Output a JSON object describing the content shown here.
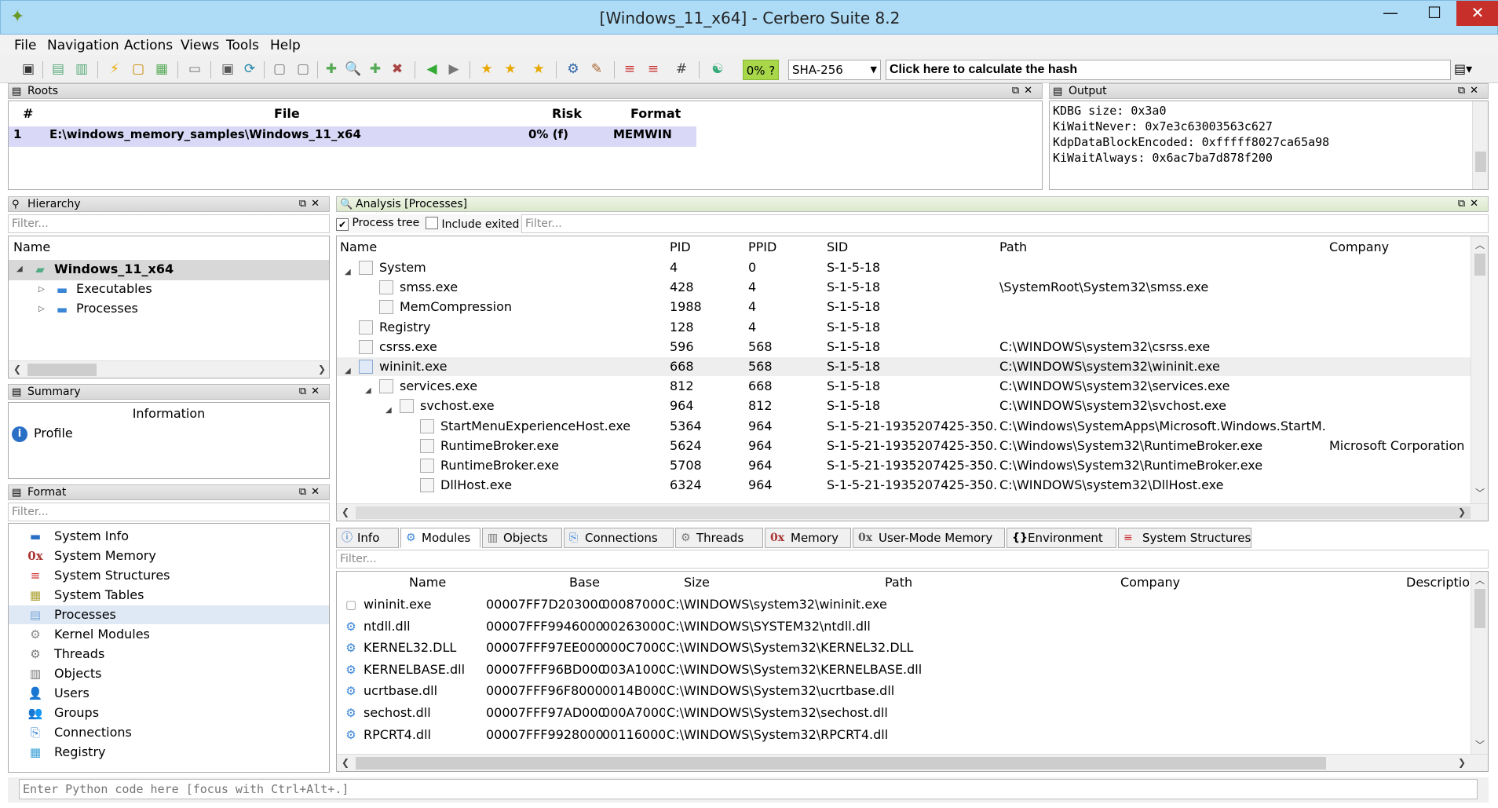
{
  "window": {
    "title": "[Windows_11_x64] - Cerbero Suite 8.2",
    "min": "—",
    "max": "☐",
    "close": "✕"
  },
  "menu": [
    "File",
    "Navigation",
    "Actions",
    "Views",
    "Tools",
    "Help"
  ],
  "toolbar": {
    "risk_badge": "0% ?",
    "hash_algo": "SHA-256",
    "hash_prompt": "Click here to calculate the hash"
  },
  "roots": {
    "title": "Roots",
    "columns": [
      "#",
      "File",
      "Risk",
      "Format"
    ],
    "rows": [
      {
        "n": "1",
        "file": "E:\\windows_memory_samples\\Windows_11_x64",
        "risk": "0% (f)",
        "format": "MEMWIN"
      }
    ]
  },
  "output": {
    "title": "Output",
    "lines": [
      "KDBG size: 0x3a0",
      "KiWaitNever: 0x7e3c63003563c627",
      "KdpDataBlockEncoded: 0xfffff8027ca65a98",
      "KiWaitAlways: 0x6ac7ba7d878f200"
    ]
  },
  "hierarchy": {
    "title": "Hierarchy",
    "filter": "Filter...",
    "column": "Name",
    "root": "Windows_11_x64",
    "children": [
      "Executables",
      "Processes"
    ]
  },
  "summary": {
    "title": "Summary",
    "column": "Information",
    "items": [
      "Profile"
    ]
  },
  "format": {
    "title": "Format",
    "filter": "Filter...",
    "items": [
      "System Info",
      "System Memory",
      "System Structures",
      "System Tables",
      "Processes",
      "Kernel Modules",
      "Threads",
      "Objects",
      "Users",
      "Groups",
      "Connections",
      "Registry"
    ]
  },
  "analysis": {
    "title": "Analysis [Processes]",
    "process_tree": "Process tree",
    "include_exited": "Include exited",
    "filter": "Filter...",
    "columns": [
      "Name",
      "PID",
      "PPID",
      "SID",
      "Path",
      "Company"
    ],
    "rows": [
      {
        "name": "System",
        "pid": "4",
        "ppid": "0",
        "sid": "S-1-5-18",
        "path": "",
        "company": ""
      },
      {
        "name": "smss.exe",
        "pid": "428",
        "ppid": "4",
        "sid": "S-1-5-18",
        "path": "\\SystemRoot\\System32\\smss.exe",
        "company": ""
      },
      {
        "name": "MemCompression",
        "pid": "1988",
        "ppid": "4",
        "sid": "S-1-5-18",
        "path": "",
        "company": ""
      },
      {
        "name": "Registry",
        "pid": "128",
        "ppid": "4",
        "sid": "S-1-5-18",
        "path": "",
        "company": ""
      },
      {
        "name": "csrss.exe",
        "pid": "596",
        "ppid": "568",
        "sid": "S-1-5-18",
        "path": "C:\\WINDOWS\\system32\\csrss.exe",
        "company": ""
      },
      {
        "name": "wininit.exe",
        "pid": "668",
        "ppid": "568",
        "sid": "S-1-5-18",
        "path": "C:\\WINDOWS\\system32\\wininit.exe",
        "company": ""
      },
      {
        "name": "services.exe",
        "pid": "812",
        "ppid": "668",
        "sid": "S-1-5-18",
        "path": "C:\\WINDOWS\\system32\\services.exe",
        "company": ""
      },
      {
        "name": "svchost.exe",
        "pid": "964",
        "ppid": "812",
        "sid": "S-1-5-18",
        "path": "C:\\WINDOWS\\system32\\svchost.exe",
        "company": ""
      },
      {
        "name": "StartMenuExperienceHost.exe",
        "pid": "5364",
        "ppid": "964",
        "sid": "S-1-5-21-1935207425-350...",
        "path": "C:\\Windows\\SystemApps\\Microsoft.Windows.StartM...",
        "company": ""
      },
      {
        "name": "RuntimeBroker.exe",
        "pid": "5624",
        "ppid": "964",
        "sid": "S-1-5-21-1935207425-350...",
        "path": "C:\\Windows\\System32\\RuntimeBroker.exe",
        "company": "Microsoft Corporation"
      },
      {
        "name": "RuntimeBroker.exe",
        "pid": "5708",
        "ppid": "964",
        "sid": "S-1-5-21-1935207425-350...",
        "path": "C:\\Windows\\System32\\RuntimeBroker.exe",
        "company": ""
      },
      {
        "name": "DllHost.exe",
        "pid": "6324",
        "ppid": "964",
        "sid": "S-1-5-21-1935207425-350...",
        "path": "C:\\WINDOWS\\system32\\DllHost.exe",
        "company": ""
      }
    ]
  },
  "tabs": [
    "Info",
    "Modules",
    "Objects",
    "Connections",
    "Threads",
    "Memory",
    "User-Mode Memory",
    "Environment",
    "System Structures"
  ],
  "modules": {
    "filter": "Filter...",
    "columns": [
      "Name",
      "Base",
      "Size",
      "Path",
      "Company",
      "Descriptio"
    ],
    "rows": [
      {
        "name": "wininit.exe",
        "base": "00007FF7D2030000",
        "size": "00087000",
        "path": "C:\\WINDOWS\\system32\\wininit.exe"
      },
      {
        "name": "ntdll.dll",
        "base": "00007FFF99460000",
        "size": "00263000",
        "path": "C:\\WINDOWS\\SYSTEM32\\ntdll.dll"
      },
      {
        "name": "KERNEL32.DLL",
        "base": "00007FFF97EE0000",
        "size": "000C7000",
        "path": "C:\\WINDOWS\\System32\\KERNEL32.DLL"
      },
      {
        "name": "KERNELBASE.dll",
        "base": "00007FFF96BD0000",
        "size": "003A1000",
        "path": "C:\\WINDOWS\\System32\\KERNELBASE.dll"
      },
      {
        "name": "ucrtbase.dll",
        "base": "00007FFF96F80000",
        "size": "0014B000",
        "path": "C:\\WINDOWS\\System32\\ucrtbase.dll"
      },
      {
        "name": "sechost.dll",
        "base": "00007FFF97AD0000",
        "size": "000A7000",
        "path": "C:\\WINDOWS\\System32\\sechost.dll"
      },
      {
        "name": "RPCRT4.dll",
        "base": "00007FFF99280000",
        "size": "00116000",
        "path": "C:\\WINDOWS\\System32\\RPCRT4.dll"
      }
    ]
  },
  "python": {
    "placeholder": "Enter Python code here [focus with Ctrl+Alt+.]"
  }
}
